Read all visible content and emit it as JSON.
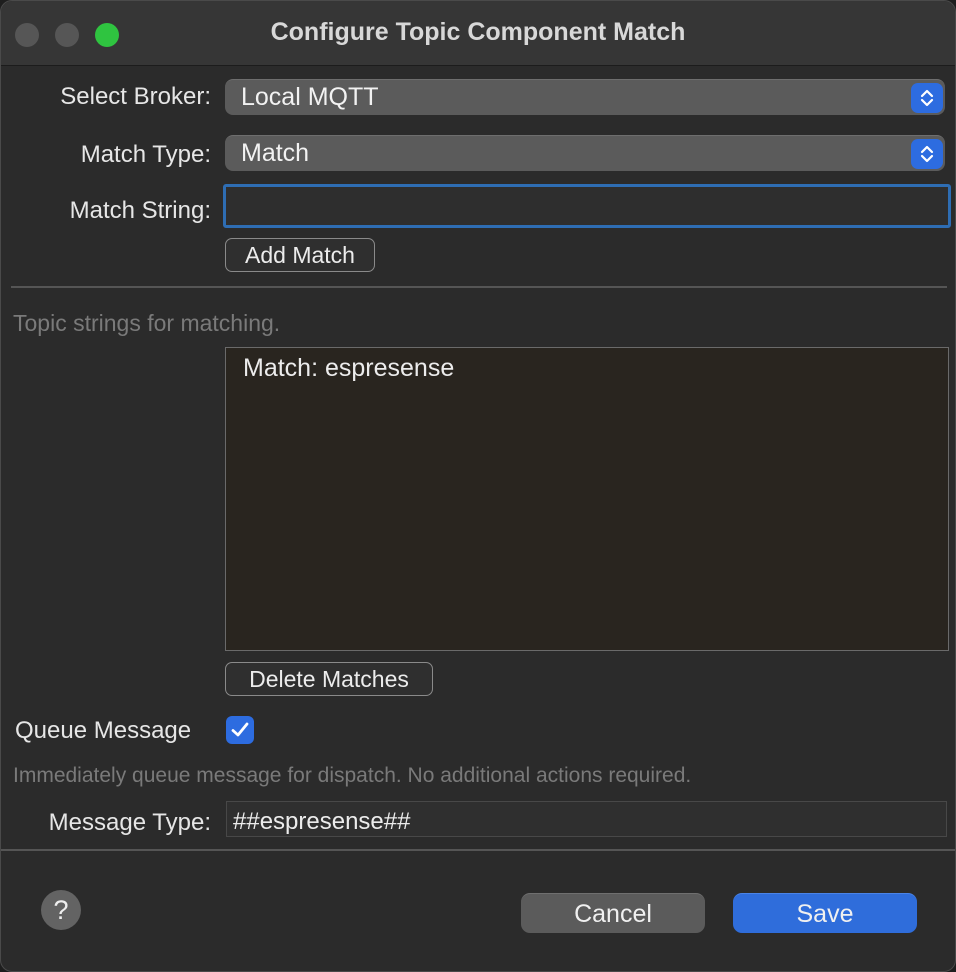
{
  "window": {
    "title": "Configure Topic Component Match"
  },
  "form": {
    "broker_label": "Select Broker:",
    "broker_value": "Local MQTT",
    "match_type_label": "Match Type:",
    "match_type_value": "Match",
    "match_string_label": "Match String:",
    "match_string_value": "",
    "add_match_label": "Add Match"
  },
  "matches": {
    "hint": "Topic strings for matching.",
    "items": [
      "Match: espresense"
    ],
    "delete_label": "Delete Matches"
  },
  "queue": {
    "label": "Queue Message",
    "checked": true,
    "hint": "Immediately queue message for dispatch.  No additional actions required."
  },
  "message": {
    "type_label": "Message Type:",
    "type_value": "##espresense##"
  },
  "footer": {
    "help_label": "?",
    "cancel_label": "Cancel",
    "save_label": "Save"
  },
  "colors": {
    "accent": "#2f6ddb",
    "window_bg": "#2b2b2b",
    "zoom_button": "#2fc440"
  }
}
